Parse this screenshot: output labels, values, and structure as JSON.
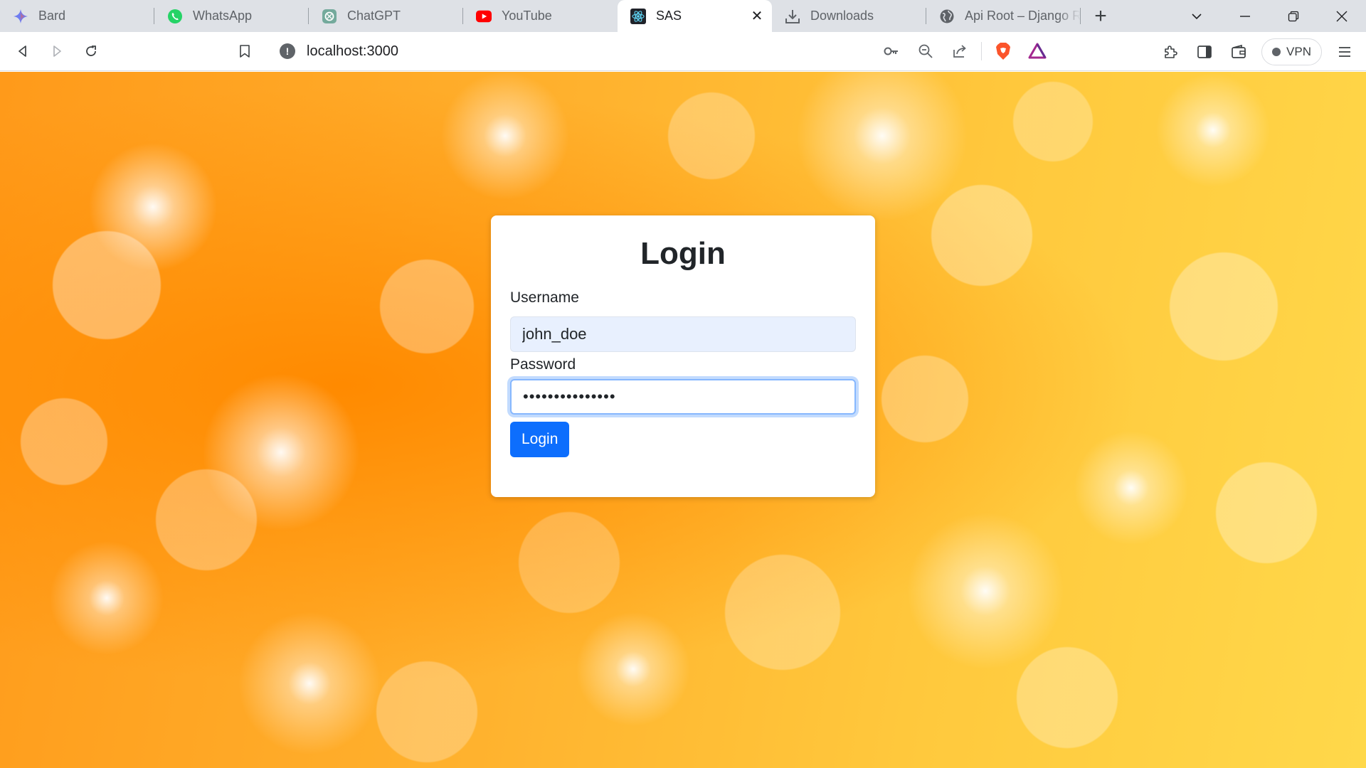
{
  "browser": {
    "tabs": [
      {
        "title": "Bard",
        "icon": "bard-icon",
        "active": false
      },
      {
        "title": "WhatsApp",
        "icon": "whatsapp-icon",
        "active": false
      },
      {
        "title": "ChatGPT",
        "icon": "chatgpt-icon",
        "active": false
      },
      {
        "title": "YouTube",
        "icon": "youtube-icon",
        "active": false
      },
      {
        "title": "SAS",
        "icon": "react-icon",
        "active": true
      },
      {
        "title": "Downloads",
        "icon": "download-icon",
        "active": false
      },
      {
        "title": "Api Root – Django R",
        "icon": "globe-icon",
        "active": false
      }
    ],
    "url": "localhost:3000",
    "vpn_label": "VPN"
  },
  "login": {
    "title": "Login",
    "username_label": "Username",
    "username_value": "john_doe",
    "password_label": "Password",
    "password_mask": "•••••••••••••••",
    "button_label": "Login"
  },
  "colors": {
    "primary": "#0d6efd",
    "focus_ring": "#86b7fe",
    "autofill_bg": "#e8f0fe",
    "background_orange": "#ff9a1a",
    "background_yellow": "#ffd84a"
  }
}
